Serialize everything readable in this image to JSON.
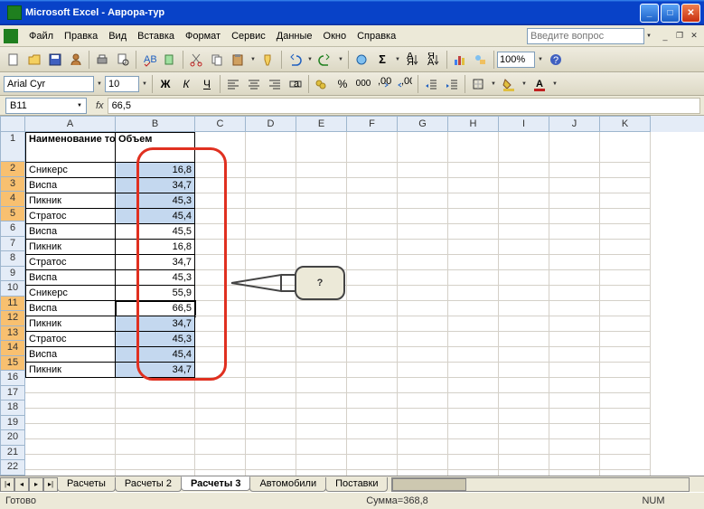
{
  "window": {
    "title": "Microsoft Excel - Аврора-тур"
  },
  "menu": {
    "file": "Файл",
    "edit": "Правка",
    "view": "Вид",
    "insert": "Вставка",
    "format": "Формат",
    "service": "Сервис",
    "data": "Данные",
    "window": "Окно",
    "help": "Справка",
    "help_placeholder": "Введите вопрос"
  },
  "toolbar": {
    "zoom": "100%"
  },
  "format": {
    "font": "Arial Cyr",
    "size": "10"
  },
  "namebox": {
    "cell": "B11",
    "formula": "66,5"
  },
  "columns": [
    "A",
    "B",
    "C",
    "D",
    "E",
    "F",
    "G",
    "H",
    "I",
    "J",
    "K"
  ],
  "headers": {
    "colA": "Наименование товара",
    "colB": "Объем"
  },
  "data_rows": [
    {
      "r": 2,
      "name": "Сникерс",
      "vol": "16,8",
      "hl": true
    },
    {
      "r": 3,
      "name": "Виспа",
      "vol": "34,7",
      "hl": true
    },
    {
      "r": 4,
      "name": "Пикник",
      "vol": "45,3",
      "hl": true
    },
    {
      "r": 5,
      "name": "Стратос",
      "vol": "45,4",
      "hl": true
    },
    {
      "r": 6,
      "name": "Виспа",
      "vol": "45,5",
      "hl": false
    },
    {
      "r": 7,
      "name": "Пикник",
      "vol": "16,8",
      "hl": false
    },
    {
      "r": 8,
      "name": "Стратос",
      "vol": "34,7",
      "hl": false
    },
    {
      "r": 9,
      "name": "Виспа",
      "vol": "45,3",
      "hl": false
    },
    {
      "r": 10,
      "name": "Сникерс",
      "vol": "55,9",
      "hl": false
    },
    {
      "r": 11,
      "name": "Виспа",
      "vol": "66,5",
      "hl": true,
      "active": true
    },
    {
      "r": 12,
      "name": "Пикник",
      "vol": "34,7",
      "hl": true
    },
    {
      "r": 13,
      "name": "Стратос",
      "vol": "45,3",
      "hl": true
    },
    {
      "r": 14,
      "name": "Виспа",
      "vol": "45,4",
      "hl": true
    },
    {
      "r": 15,
      "name": "Пикник",
      "vol": "34,7",
      "hl": true
    }
  ],
  "callout": {
    "text": "?"
  },
  "tabs": [
    "Расчеты",
    "Расчеты 2",
    "Расчеты 3",
    "Автомобили",
    "Поставки"
  ],
  "active_tab": 2,
  "status": {
    "ready": "Готово",
    "sum": "Сумма=368,8",
    "num": "NUM"
  }
}
